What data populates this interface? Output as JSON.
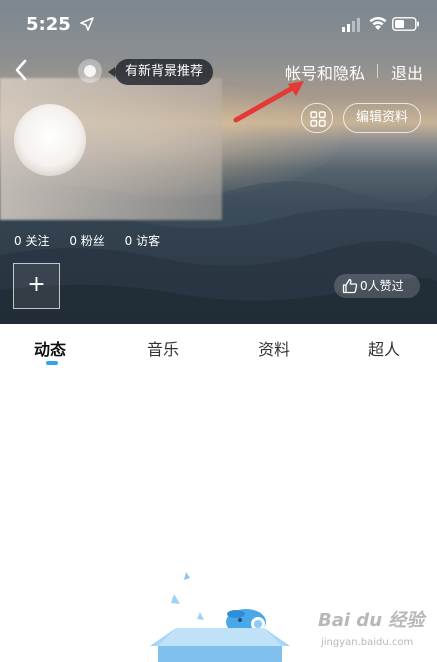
{
  "status_bar": {
    "time": "5:25"
  },
  "nav": {
    "tooltip": "有新背景推荐",
    "account_privacy": "帐号和隐私",
    "logout": "退出"
  },
  "profile": {
    "edit_label": "编辑资料",
    "stats": [
      {
        "count": "0",
        "label": "关注"
      },
      {
        "count": "0",
        "label": "粉丝"
      },
      {
        "count": "0",
        "label": "访客"
      }
    ],
    "add_label": "+",
    "likes": "0人赞过"
  },
  "tabs": [
    {
      "label": "动态",
      "active": true
    },
    {
      "label": "音乐",
      "active": false
    },
    {
      "label": "资料",
      "active": false
    },
    {
      "label": "超人",
      "active": false
    }
  ],
  "colors": {
    "accent": "#33a3f0",
    "arrow": "#e53935"
  },
  "watermark": {
    "main": "Bai du 经验",
    "sub": "jingyan.baidu.com"
  }
}
